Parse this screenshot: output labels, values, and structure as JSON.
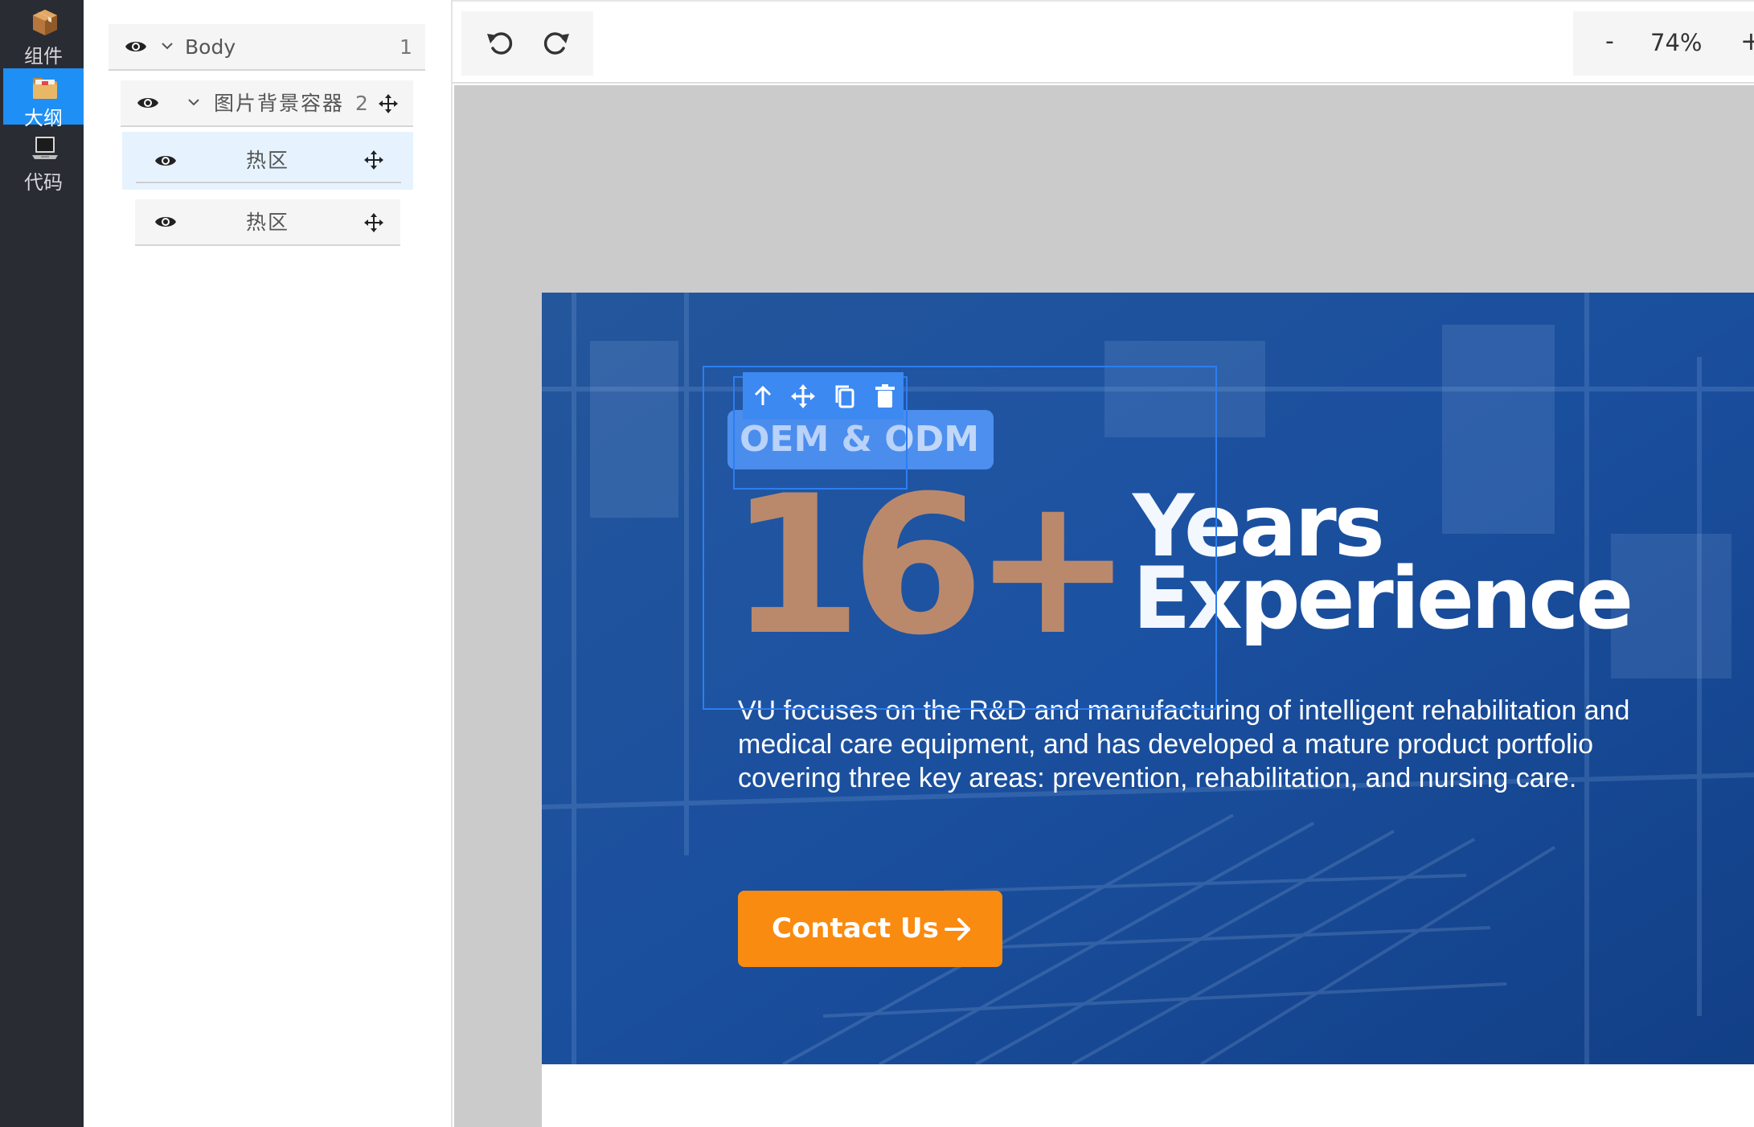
{
  "rail": {
    "items": [
      {
        "label": "组件",
        "icon": "package-icon",
        "active": false
      },
      {
        "label": "大纲",
        "icon": "folder-icon",
        "active": true
      },
      {
        "label": "代码",
        "icon": "laptop-icon",
        "active": false
      }
    ]
  },
  "outline": {
    "body": {
      "label": "Body",
      "count": "1"
    },
    "container": {
      "label": "图片背景容器",
      "count": "2"
    },
    "hotzones": [
      {
        "label": "热区",
        "selected": true
      },
      {
        "label": "热区",
        "selected": false
      }
    ]
  },
  "toolbar": {
    "undo_icon": "undo-icon",
    "redo_icon": "redo-icon",
    "zoom_minus": "-",
    "zoom_value": "74%",
    "zoom_plus": "+"
  },
  "hero": {
    "badge": "OEM & ODM",
    "stat_number": "16+",
    "stat_line1": "Years",
    "stat_line2": "Experience",
    "description": "VU focuses on the R&D and manufacturing of intelligent rehabilitation and medical care equipment, and has developed a mature product portfolio covering three key areas: prevention, rehabilitation, and nursing care.",
    "cta_label": "Contact Us",
    "colors": {
      "background": "#174e9c",
      "accent": "#f98b10",
      "number": "#c38b63",
      "badge": "#4f91ef"
    }
  },
  "selection": {
    "tools": [
      "arrow-up-icon",
      "move-icon",
      "copy-icon",
      "trash-icon"
    ],
    "color": "#2d7ef0"
  }
}
